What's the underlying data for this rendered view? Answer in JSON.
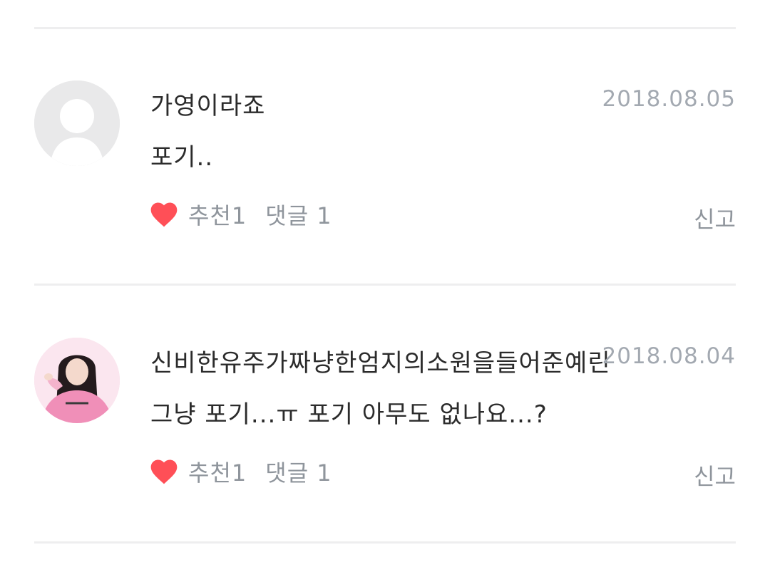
{
  "comments": [
    {
      "nickname": "가영이라죠",
      "date": "2018.08.05",
      "body": "포기..",
      "like_label": "추천1",
      "reply_label": "댓글 1",
      "report_label": "신고",
      "avatar": "default-avatar"
    },
    {
      "nickname": "신비한유주가짜냥한엄지의소원을들어준예린",
      "date": "2018.08.04",
      "body": "그냥 포기...ㅠ 포기 아무도 없나요...?",
      "like_label": "추천1",
      "reply_label": "댓글 1",
      "report_label": "신고",
      "avatar": "profile-photo"
    }
  ],
  "colors": {
    "heart": "#ff4f57",
    "text_primary": "#2b2b2b",
    "text_meta": "#a3a9b1",
    "text_action": "#8f959c",
    "divider": "#eeeeef"
  }
}
